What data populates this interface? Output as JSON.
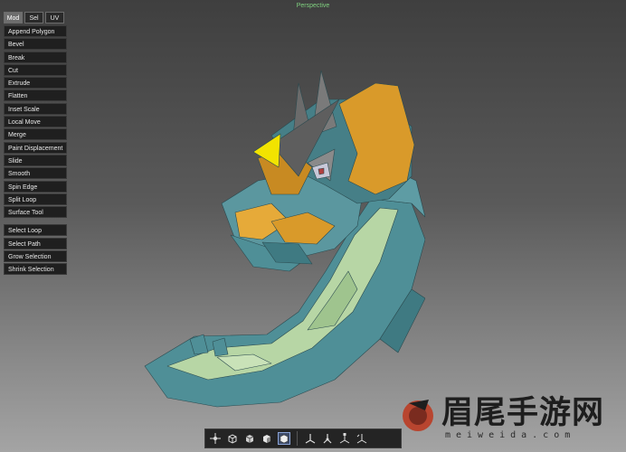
{
  "viewport": {
    "title": "Perspective"
  },
  "mode_tabs": [
    {
      "label": "Mod",
      "active": true
    },
    {
      "label": "Sel",
      "active": false
    },
    {
      "label": "UV",
      "active": false
    }
  ],
  "mod_tools": [
    "Append Polygon",
    "Bevel",
    "Break",
    "Cut",
    "Extrude",
    "Flatten",
    "Inset Scale",
    "Local Move",
    "Merge",
    "Paint Displacement",
    "Slide",
    "Smooth",
    "Spin Edge",
    "Split Loop",
    "Surface Tool"
  ],
  "selection_tools": [
    "Select Loop",
    "Select Path",
    "Grow Selection",
    "Shrink Selection"
  ],
  "bottom_toolbar": {
    "icons": [
      "pivot-icon",
      "cube-wire-icon",
      "cube-solid-icon",
      "cube-textured-icon",
      "cube-shaded-icon",
      "axis-move-icon",
      "axis-rotate-icon",
      "axis-scale-icon",
      "axis-universal-icon"
    ],
    "active_index": 4
  },
  "watermark": {
    "title": "眉尾手游网",
    "subtitle": "meiweida.com"
  },
  "colors": {
    "mesh_teal": "#4f8f97",
    "mesh_green": "#b7d6a5",
    "mesh_orange": "#d99a2a",
    "mesh_yellow": "#f2e300",
    "mesh_grey": "#6b6b6b",
    "viewport_title": "#7fd07f"
  }
}
